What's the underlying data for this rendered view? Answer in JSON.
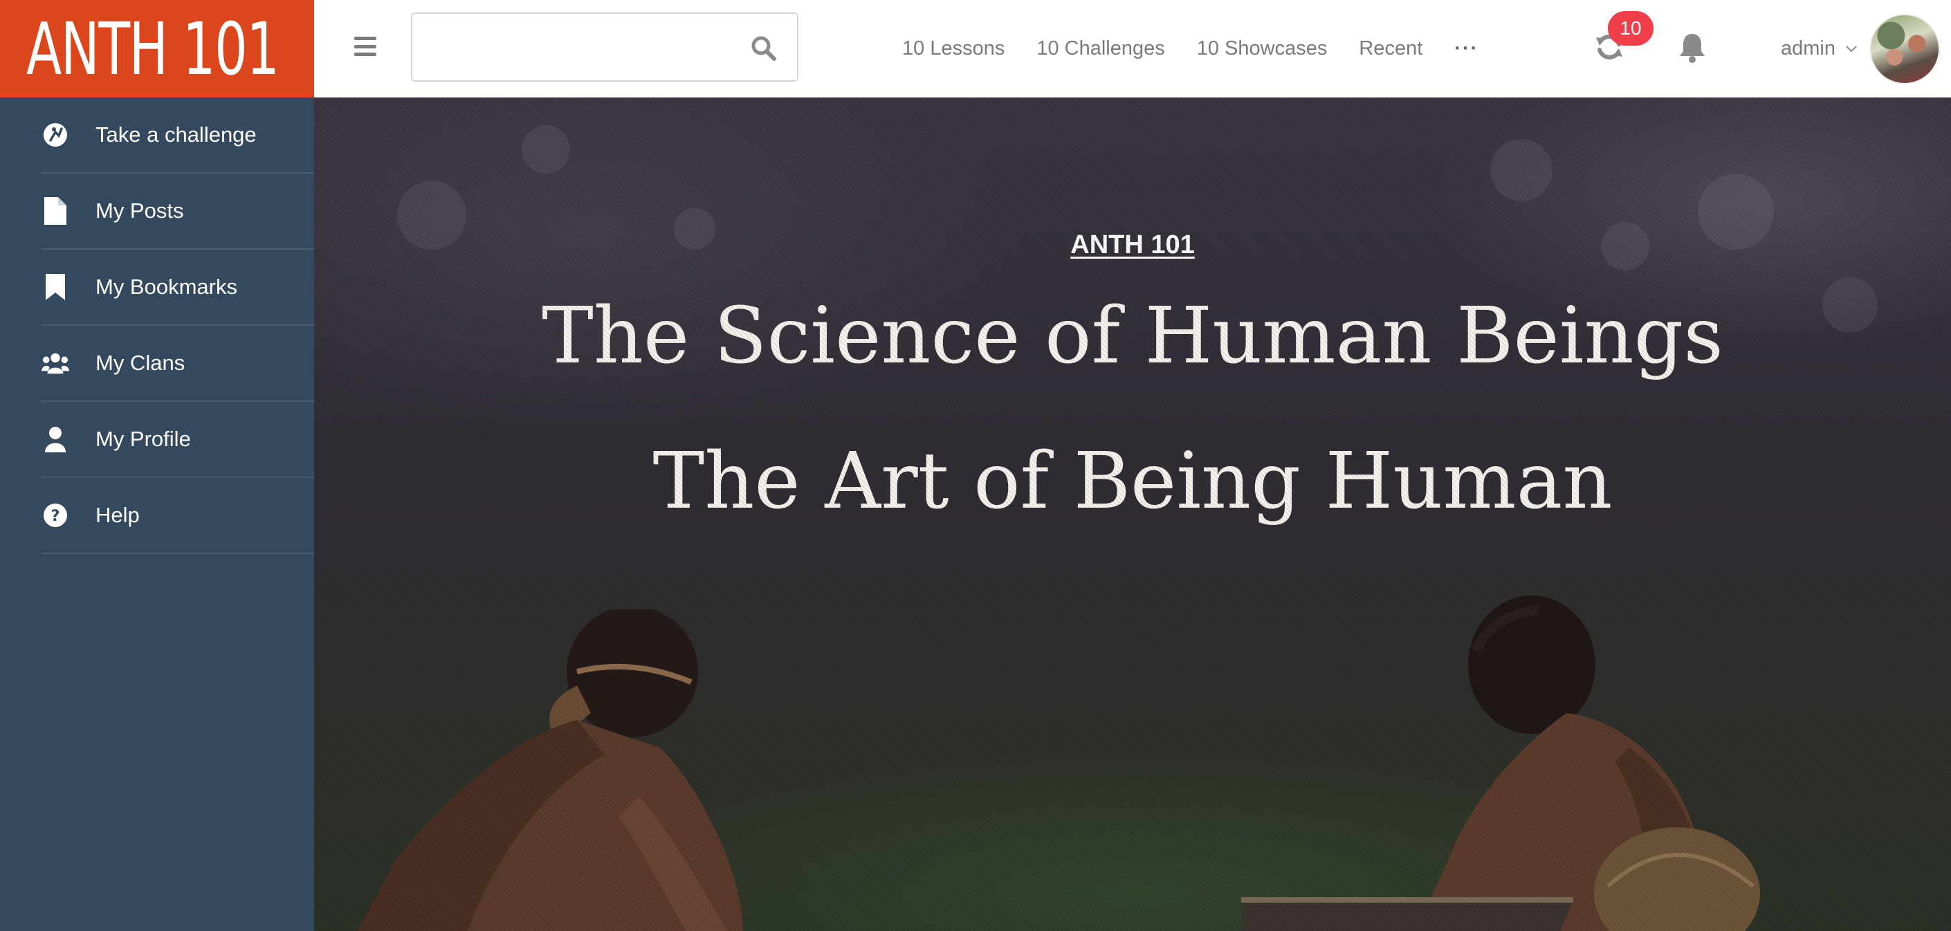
{
  "brand": {
    "text": "ANTH 101",
    "color": "#dc461c"
  },
  "search": {
    "placeholder": "",
    "value": "",
    "icon": "search-icon"
  },
  "nav": {
    "items": [
      {
        "label": "10 Lessons"
      },
      {
        "label": "10 Challenges"
      },
      {
        "label": "10 Showcases"
      },
      {
        "label": "Recent"
      }
    ],
    "more_label": "···"
  },
  "notifications": {
    "sync_count": "10",
    "badge_color": "#ef3e4a"
  },
  "user": {
    "name": "admin"
  },
  "sidebar": {
    "background": "#34495e",
    "items": [
      {
        "label": "Take a challenge",
        "icon": "compass-challenge-icon"
      },
      {
        "label": "My Posts",
        "icon": "document-icon"
      },
      {
        "label": "My Bookmarks",
        "icon": "bookmark-icon"
      },
      {
        "label": "My Clans",
        "icon": "users-group-icon"
      },
      {
        "label": "My Profile",
        "icon": "user-icon"
      },
      {
        "label": "Help",
        "icon": "question-circle-icon"
      }
    ]
  },
  "hero": {
    "kicker": "ANTH 101",
    "headline_1": "The Science of Human Beings",
    "headline_2": "The Art of Being Human"
  }
}
